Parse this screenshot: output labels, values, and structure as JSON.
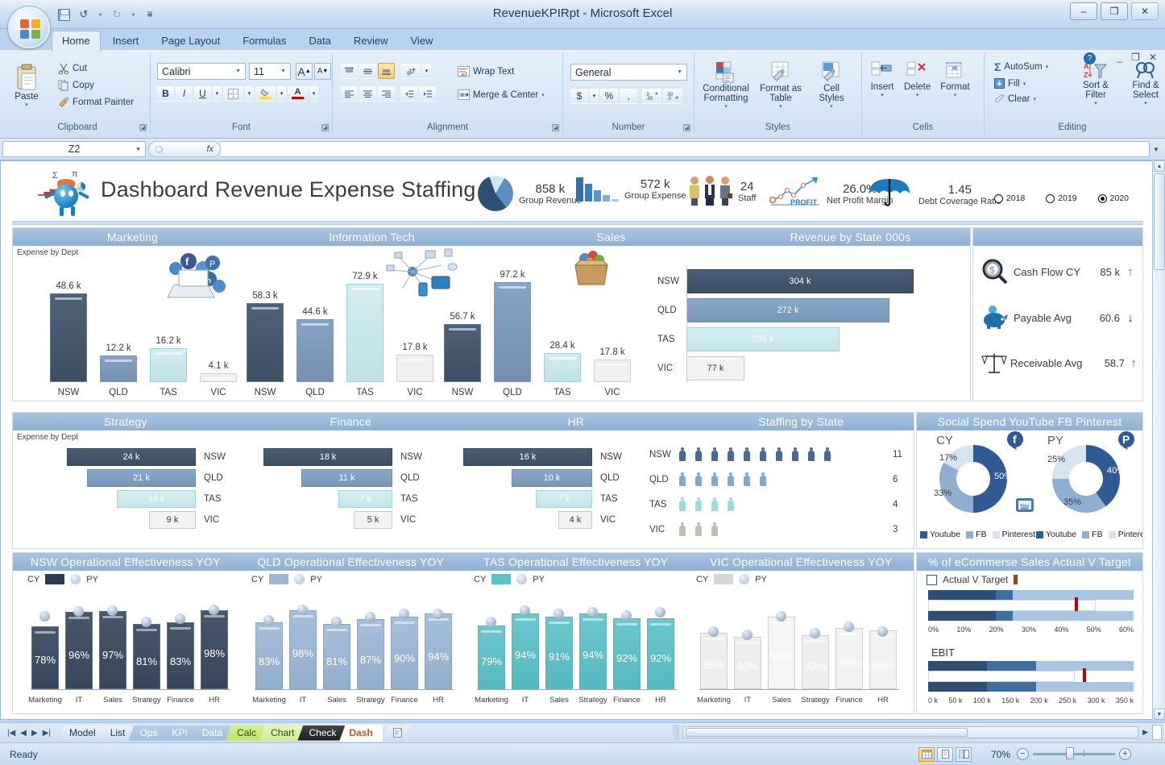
{
  "window": {
    "title": "RevenueKPIRpt - Microsoft Excel",
    "minimize": "–",
    "restore": "❐",
    "close": "✕"
  },
  "qat": {
    "save": "save-icon",
    "undo": "↺",
    "redo": "↻",
    "customize": "▾"
  },
  "ribbon": {
    "tabs": [
      "Home",
      "Insert",
      "Page Layout",
      "Formulas",
      "Data",
      "Review",
      "View"
    ],
    "active_tab": "Home",
    "clipboard": {
      "label": "Clipboard",
      "paste": "Paste",
      "cut": "Cut",
      "copy": "Copy",
      "format_painter": "Format Painter"
    },
    "font": {
      "label": "Font",
      "family": "Calibri",
      "size": "11",
      "grow": "A",
      "shrink": "A",
      "bold": "B",
      "italic": "I",
      "underline": "U",
      "borders": "▦",
      "fill_color": "A",
      "font_color": "A"
    },
    "alignment": {
      "label": "Alignment",
      "wrap_text": "Wrap Text",
      "merge_center": "Merge & Center"
    },
    "number": {
      "label": "Number",
      "format": "General",
      "currency": "$",
      "percent": "%",
      "comma": ",",
      "increase_decimal": "→.0",
      "decrease_decimal": "←.0"
    },
    "styles": {
      "label": "Styles",
      "conditional_formatting": "Conditional Formatting",
      "format_as_table": "Format as Table",
      "cell_styles": "Cell Styles"
    },
    "cells": {
      "label": "Cells",
      "insert": "Insert",
      "delete": "Delete",
      "format": "Format"
    },
    "editing": {
      "label": "Editing",
      "autosum": "AutoSum",
      "fill": "Fill",
      "clear": "Clear",
      "sort_filter": "Sort & Filter",
      "find_select": "Find & Select"
    }
  },
  "formula_bar": {
    "name_box": "Z2",
    "formula": "",
    "fx": "fx"
  },
  "dashboard": {
    "title": "Dashboard Revenue Expense Staffing",
    "kpis": [
      {
        "value": "858 k",
        "label": "Group Revenue",
        "icon": "pie-chart-icon"
      },
      {
        "value": "572 k",
        "label": "Group Expense",
        "icon": "bar-chart-icon"
      },
      {
        "value": "24",
        "label": "Staff",
        "icon": "people-icon"
      },
      {
        "value": "26.0%",
        "label": "Net Profit Margin",
        "icon": "profit-line-icon"
      },
      {
        "value": "1.45",
        "label": "Debt Coverage Ratio",
        "icon": "umbrella-icon"
      }
    ],
    "year_options": [
      {
        "label": "2018",
        "selected": false
      },
      {
        "label": "2019",
        "selected": false
      },
      {
        "label": "2020",
        "selected": true
      }
    ],
    "expense_by_dept_label": "Expense by Dept",
    "dept_panel_titles": [
      "Marketing",
      "Information Tech",
      "Sales"
    ],
    "dept_panel_titles_2": [
      "Strategy",
      "Finance",
      "HR"
    ],
    "revenue_by_state_title": "Revenue by State 000s",
    "staffing_by_state_title": "Staffing by State",
    "social_title": "Social Spend YouTube FB Pinterest",
    "ecommerce_title": "% of eCommerse Sales Actual V Target",
    "ecommerce_legend": "Actual V Target",
    "ebit_label": "EBIT",
    "cards": [
      {
        "label": "Cash Flow CY",
        "value": "85 k",
        "trend": "up",
        "icon": "cash-search-icon"
      },
      {
        "label": "Payable Avg",
        "value": "60.6",
        "trend": "down",
        "icon": "piggy-bank-icon"
      },
      {
        "label": "Receivable Avg",
        "value": "58.7",
        "trend": "up",
        "icon": "scales-icon"
      }
    ],
    "yoy_titles": [
      "NSW Operational Effectiveness YOY",
      "QLD Operational Effectiveness YOY",
      "TAS Operational Effectiveness YOY",
      "VIC Operational Effectiveness YOY"
    ],
    "yoy_legend": {
      "cy": "CY",
      "py": "PY"
    }
  },
  "chart_data": [
    {
      "type": "bar",
      "title": "Marketing",
      "ylabel": "Expense by Dept",
      "categories": [
        "NSW",
        "QLD",
        "TAS",
        "VIC"
      ],
      "values": [
        48.6,
        12.2,
        16.2,
        4.1
      ],
      "labels": [
        "48.6 k",
        "12.2 k",
        "16.2 k",
        "4.1 k"
      ],
      "colors": [
        "#46596f",
        "#7e9dc0",
        "#cfe9ec",
        "#efefef"
      ]
    },
    {
      "type": "bar",
      "title": "Information Tech",
      "categories": [
        "NSW",
        "QLD",
        "TAS",
        "VIC"
      ],
      "values": [
        58.3,
        44.6,
        72.9,
        17.8
      ],
      "labels": [
        "58.3 k",
        "44.6 k",
        "72.9 k",
        "17.8 k"
      ],
      "colors": [
        "#46596f",
        "#7e9dc0",
        "#cfe9ec",
        "#efefef"
      ]
    },
    {
      "type": "bar",
      "title": "Sales",
      "categories": [
        "NSW",
        "QLD",
        "TAS",
        "VIC"
      ],
      "values": [
        56.7,
        97.2,
        28.4,
        17.8
      ],
      "labels": [
        "56.7 k",
        "97.2 k",
        "28.4 k",
        "17.8 k"
      ],
      "colors": [
        "#46596f",
        "#7e9dc0",
        "#cfe9ec",
        "#efefef"
      ]
    },
    {
      "type": "bar",
      "title": "Revenue by State 000s",
      "orientation": "horizontal",
      "categories": [
        "NSW",
        "QLD",
        "TAS",
        "VIC"
      ],
      "values": [
        304,
        272,
        205,
        77
      ],
      "labels": [
        "304 k",
        "272 k",
        "205 k",
        "77 k"
      ],
      "colors": [
        "#3f5470",
        "#7b9cc2",
        "#cae7ec",
        "#f0f0f0"
      ]
    },
    {
      "type": "bar",
      "title": "Strategy",
      "orientation": "horizontal",
      "ylabel": "Expense by Dept",
      "categories": [
        "NSW",
        "QLD",
        "TAS",
        "VIC"
      ],
      "values": [
        24,
        21,
        15,
        9
      ],
      "labels": [
        "24 k",
        "21 k",
        "15 k",
        "9 k"
      ],
      "colors": [
        "#46596f",
        "#7e9dc0",
        "#cfe9ec",
        "#efefef"
      ]
    },
    {
      "type": "bar",
      "title": "Finance",
      "orientation": "horizontal",
      "categories": [
        "NSW",
        "QLD",
        "TAS",
        "VIC"
      ],
      "values": [
        18,
        11,
        7,
        5
      ],
      "labels": [
        "18 k",
        "11 k",
        "7 k",
        "5 k"
      ],
      "colors": [
        "#46596f",
        "#7e9dc0",
        "#cfe9ec",
        "#efefef"
      ]
    },
    {
      "type": "bar",
      "title": "HR",
      "orientation": "horizontal",
      "categories": [
        "NSW",
        "QLD",
        "TAS",
        "VIC"
      ],
      "values": [
        16,
        10,
        7,
        4
      ],
      "labels": [
        "16 k",
        "10 k",
        "7 k",
        "4 k"
      ],
      "colors": [
        "#46596f",
        "#7e9dc0",
        "#cfe9ec",
        "#efefef"
      ]
    },
    {
      "type": "pictogram",
      "title": "Staffing by State",
      "categories": [
        "NSW",
        "QLD",
        "TAS",
        "VIC"
      ],
      "values": [
        11,
        6,
        4,
        3
      ],
      "icons": [
        10,
        6,
        4,
        3
      ],
      "colors": [
        "#4a6a92",
        "#85a9cd",
        "#9fd8de",
        "#c3bfb0"
      ]
    },
    {
      "type": "pie",
      "title": "Social Spend CY",
      "subtitle": "CY",
      "labels": [
        "Youtube",
        "FB",
        "Pinterest"
      ],
      "values": [
        50,
        33,
        17
      ],
      "value_labels": [
        "50%",
        "33%",
        "17%"
      ],
      "colors": [
        "#2f5a94",
        "#8fafd0",
        "#d6e3f0"
      ],
      "legend": [
        "Youtube",
        "FB",
        "Pinterest"
      ]
    },
    {
      "type": "pie",
      "title": "Social Spend PY",
      "subtitle": "PY",
      "labels": [
        "Youtube",
        "FB",
        "Pinterest"
      ],
      "values": [
        40,
        35,
        25
      ],
      "value_labels": [
        "40%",
        "35%",
        "25%"
      ],
      "colors": [
        "#2f5a94",
        "#8fafd0",
        "#d6e3f0"
      ],
      "legend": [
        "Youtube",
        "FB",
        "Pinterest"
      ]
    },
    {
      "type": "bar",
      "title": "NSW Operational Effectiveness YOY",
      "categories": [
        "Marketing",
        "IT",
        "Sales",
        "Strategy",
        "Finance",
        "HR"
      ],
      "series": [
        {
          "name": "CY",
          "values": [
            78,
            96,
            97,
            81,
            83,
            98
          ]
        },
        {
          "name": "PY",
          "values": [
            82,
            99,
            99,
            85,
            87,
            99
          ]
        }
      ],
      "labels": [
        "78%",
        "96%",
        "97%",
        "81%",
        "83%",
        "98%"
      ],
      "color": "#3b4d63",
      "ylim": [
        0,
        100
      ]
    },
    {
      "type": "bar",
      "title": "QLD Operational Effectiveness YOY",
      "categories": [
        "Marketing",
        "IT",
        "Sales",
        "Strategy",
        "Finance",
        "HR"
      ],
      "series": [
        {
          "name": "CY",
          "values": [
            83,
            98,
            81,
            87,
            90,
            94
          ]
        },
        {
          "name": "PY",
          "values": [
            82,
            99,
            85,
            90,
            93,
            95
          ]
        }
      ],
      "labels": [
        "83%",
        "98%",
        "81%",
        "87%",
        "90%",
        "94%"
      ],
      "color": "#9db8d6",
      "ylim": [
        0,
        100
      ]
    },
    {
      "type": "bar",
      "title": "TAS Operational Effectiveness YOY",
      "categories": [
        "Marketing",
        "IT",
        "Sales",
        "Strategy",
        "Finance",
        "HR"
      ],
      "series": [
        {
          "name": "CY",
          "values": [
            79,
            94,
            91,
            94,
            92,
            92
          ]
        },
        {
          "name": "PY",
          "values": [
            83,
            97,
            95,
            96,
            93,
            96
          ]
        }
      ],
      "labels": [
        "79%",
        "94%",
        "91%",
        "94%",
        "92%",
        "92%"
      ],
      "color": "#5ec0c6",
      "ylim": [
        0,
        100
      ]
    },
    {
      "type": "bar",
      "title": "VIC Operational Effectiveness YOY",
      "categories": [
        "Marketing",
        "IT",
        "Sales",
        "Strategy",
        "Finance",
        "HR"
      ],
      "series": [
        {
          "name": "CY",
          "values": [
            85,
            80,
            99,
            82,
            89,
            88
          ]
        },
        {
          "name": "PY",
          "values": [
            87,
            83,
            101,
            86,
            92,
            90
          ]
        }
      ],
      "labels": [
        "85%",
        "80%",
        "99%",
        "82%",
        "89%",
        "88%"
      ],
      "color": "#ededed",
      "ylim": [
        0,
        100
      ]
    },
    {
      "type": "bar",
      "title": "% of eCommerse Sales Actual V Target",
      "orientation": "bullet",
      "axis_ticks": [
        "0%",
        "10%",
        "20%",
        "30%",
        "40%",
        "50%",
        "60%"
      ],
      "actual": 25,
      "target": 45,
      "max": 60,
      "bands": [
        20,
        25,
        60
      ]
    },
    {
      "type": "bar",
      "title": "EBIT",
      "orientation": "bullet",
      "axis_ticks": [
        "0 k",
        "50 k",
        "100 k",
        "150 k",
        "200 k",
        "250 k",
        "300 k",
        "350 k"
      ],
      "actual": 200,
      "target": 300,
      "max": 350,
      "bands": [
        100,
        200,
        350
      ]
    }
  ],
  "sheet_tabs": [
    {
      "label": "Model",
      "color": "#17395c",
      "active": false
    },
    {
      "label": "List",
      "color": "#17395c",
      "active": false
    },
    {
      "label": "Ops",
      "color": "#ffffff",
      "bg": "#9fc0e0",
      "active": false
    },
    {
      "label": "KPI",
      "color": "#ffffff",
      "bg": "#9fc0e0",
      "active": false
    },
    {
      "label": "Data",
      "color": "#ffffff",
      "bg": "#9fc0e0",
      "active": false
    },
    {
      "label": "Calc",
      "color": "#17395c",
      "bg": "#c6e97a",
      "active": false
    },
    {
      "label": "Chart",
      "color": "#17395c",
      "bg": "#d9f0a0",
      "active": false
    },
    {
      "label": "Check",
      "color": "#ffffff",
      "bg": "#2b2b2b",
      "active": false
    },
    {
      "label": "Dash",
      "color": "#c05621",
      "active": true
    }
  ],
  "status_bar": {
    "ready": "Ready",
    "zoom": "70%",
    "zoom_out": "−",
    "zoom_in": "+"
  }
}
